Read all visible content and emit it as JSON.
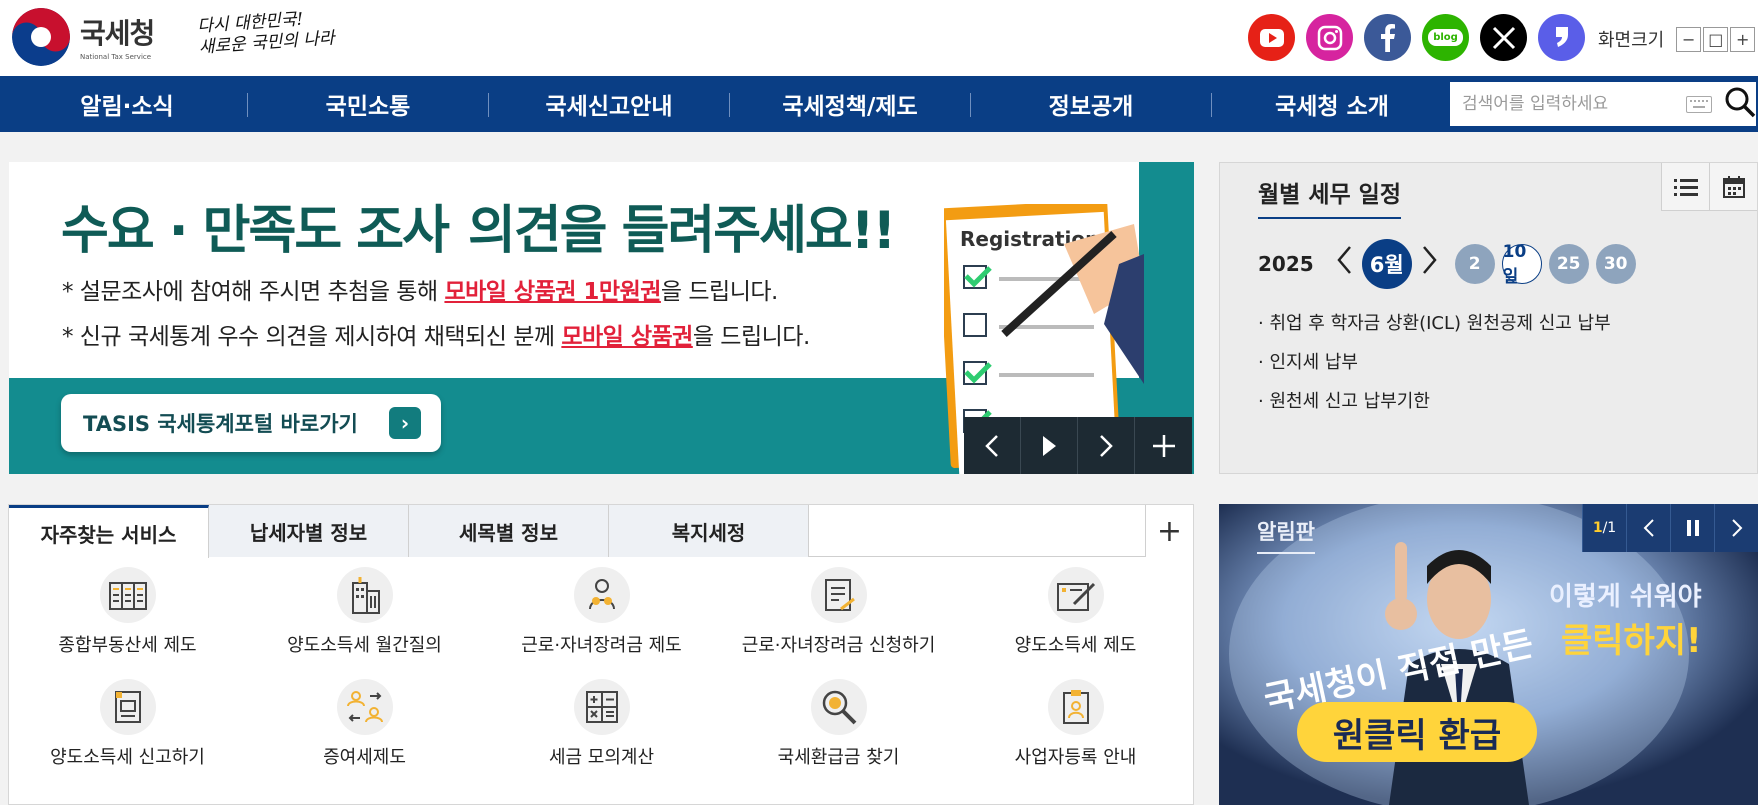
{
  "header": {
    "logo_ko": "국세청",
    "logo_en": "National Tax Service",
    "slogan_line1": "다시 대한민국!",
    "slogan_line2": "새로운 국민의 나라",
    "sns": [
      {
        "icon": "youtube-icon",
        "color": "#e62117"
      },
      {
        "icon": "instagram-icon",
        "color": "#d6249f"
      },
      {
        "icon": "facebook-icon",
        "color": "#3b5998"
      },
      {
        "icon": "blog-icon",
        "color": "#2db400"
      },
      {
        "icon": "x-icon",
        "color": "#000000"
      },
      {
        "icon": "story-icon",
        "color": "#5a5ee8"
      }
    ],
    "blog_label": "blog",
    "zoom_label": "화면크기",
    "zoom_out": "−",
    "zoom_reset": "□",
    "zoom_in": "+"
  },
  "nav": {
    "items": [
      "알림·소식",
      "국민소통",
      "국세신고안내",
      "국세정책/제도",
      "정보공개",
      "국세청 소개"
    ],
    "search_placeholder": "검색어를 입력하세요"
  },
  "banner": {
    "title_a": "수요 · 만족도 조사",
    "title_b": "의견을 들려주세요!!",
    "line1_a": "* 설문조사에 참여해 주시면 추첨을 통해 ",
    "line1_red": "모바일 상품권 1만원권",
    "line1_b": "을 드립니다.",
    "line2_a": "* 신규 국세통계 우수 의견을 제시하여 채택되신 분께 ",
    "line2_red": "모바일 상품권",
    "line2_b": "을 드립니다.",
    "button": "TASIS 국세통계포털 바로가기",
    "clipboard_label": "Registration"
  },
  "schedule": {
    "title": "월별 세무 일정",
    "year": "2025",
    "month": "6월",
    "days": [
      "2",
      "10일",
      "25",
      "30"
    ],
    "active_day_index": 1,
    "items": [
      "· 취업 후 학자금 상환(ICL) 원천공제 신고 납부",
      "· 인지세 납부",
      "· 원천세 신고 납부기한"
    ]
  },
  "services": {
    "tabs": [
      "자주찾는 서비스",
      "납세자별 정보",
      "세목별 정보",
      "복지세정"
    ],
    "plus": "+",
    "items": [
      {
        "label": "종합부동산세 제도",
        "icon": "building-grid-icon"
      },
      {
        "label": "양도소득세 월간질의",
        "icon": "apartment-icon"
      },
      {
        "label": "근로·자녀장려금 제도",
        "icon": "family-icon"
      },
      {
        "label": "근로·자녀장려금 신청하기",
        "icon": "document-edit-icon"
      },
      {
        "label": "양도소득세 제도",
        "icon": "pen-tablet-icon"
      },
      {
        "label": "양도소득세 신고하기",
        "icon": "form-icon"
      },
      {
        "label": "증여세제도",
        "icon": "people-exchange-icon"
      },
      {
        "label": "세금 모의계산",
        "icon": "calculator-icon"
      },
      {
        "label": "국세환급금 찾기",
        "icon": "magnifier-coin-icon"
      },
      {
        "label": "사업자등록 안내",
        "icon": "id-card-icon"
      }
    ]
  },
  "notice": {
    "title": "알림판",
    "page_current": "1",
    "page_total": "/1",
    "art_line1": "이렇게 쉬워야",
    "art_line2": "클릭하지!",
    "art_line3": "국세청이 직접 만든",
    "art_line4": "원클릭 환급"
  }
}
